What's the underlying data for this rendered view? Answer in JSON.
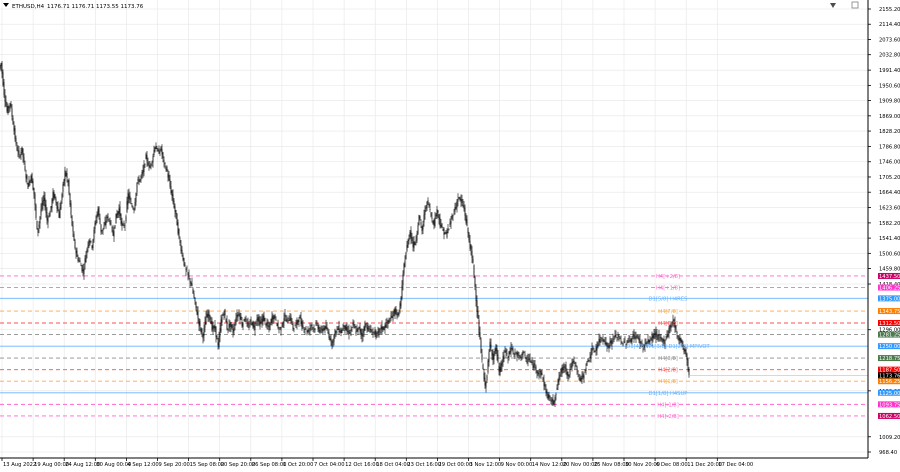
{
  "header": {
    "symbol": "ETHUSD,H4",
    "ohlc": "1176.71 1176.71 1173.55 1173.76"
  },
  "colors": {
    "background": "#ffffff",
    "grid": "#e6e6e6",
    "candle": "#000000",
    "axis_text": "#000000",
    "pink": "#ff66cc",
    "blue": "#66b3ff",
    "orange": "#ffa640",
    "red": "#ff4d4d",
    "gray": "#8c8c8c"
  },
  "chart_data": {
    "type": "candlestick",
    "title": "ETHUSD,H4",
    "y_ticks": [
      "2155.20",
      "2114.40",
      "2073.60",
      "2032.80",
      "1991.40",
      "1950.60",
      "1909.80",
      "1869.00",
      "1828.20",
      "1786.80",
      "1746.00",
      "1705.20",
      "1664.40",
      "1623.60",
      "1582.20",
      "1541.40",
      "1500.60",
      "1459.80",
      "1418.40",
      "1296.00",
      "1132.20",
      "1009.20",
      "968.40"
    ],
    "y_range": [
      955,
      2175
    ],
    "x_ticks": [
      "13 Aug 2022",
      "19 Aug 00:00",
      "24 Aug 12:00",
      "30 Aug 00:00",
      "4 Sep 12:00",
      "9 Sep 20:00",
      "15 Sep 08:00",
      "20 Sep 20:00",
      "26 Sep 08:00",
      "1 Oct 20:00",
      "7 Oct 04:00",
      "12 Oct 16:00",
      "18 Oct 04:00",
      "23 Oct 16:00",
      "29 Oct 00:00",
      "3 Nov 12:00",
      "9 Nov 00:00",
      "14 Nov 12:00",
      "20 Nov 00:00",
      "25 Nov 08:00",
      "30 Nov 20:00",
      "6 Dec 08:00",
      "11 Dec 20:00",
      "17 Dec 04:00"
    ],
    "close_path": [
      [
        0,
        1996
      ],
      [
        2,
        2010
      ],
      [
        5,
        1930
      ],
      [
        8,
        1880
      ],
      [
        11,
        1905
      ],
      [
        14,
        1850
      ],
      [
        17,
        1790
      ],
      [
        20,
        1760
      ],
      [
        23,
        1780
      ],
      [
        26,
        1720
      ],
      [
        29,
        1680
      ],
      [
        32,
        1710
      ],
      [
        35,
        1660
      ],
      [
        38,
        1560
      ],
      [
        40,
        1580
      ],
      [
        42,
        1620
      ],
      [
        45,
        1650
      ],
      [
        48,
        1590
      ],
      [
        51,
        1610
      ],
      [
        54,
        1660
      ],
      [
        57,
        1640
      ],
      [
        60,
        1600
      ],
      [
        63,
        1660
      ],
      [
        66,
        1720
      ],
      [
        69,
        1690
      ],
      [
        72,
        1600
      ],
      [
        75,
        1530
      ],
      [
        78,
        1490
      ],
      [
        81,
        1475
      ],
      [
        84,
        1450
      ],
      [
        87,
        1500
      ],
      [
        90,
        1540
      ],
      [
        93,
        1520
      ],
      [
        96,
        1580
      ],
      [
        99,
        1620
      ],
      [
        102,
        1560
      ],
      [
        105,
        1570
      ],
      [
        108,
        1600
      ],
      [
        111,
        1585
      ],
      [
        114,
        1550
      ],
      [
        117,
        1600
      ],
      [
        120,
        1620
      ],
      [
        123,
        1570
      ],
      [
        126,
        1580
      ],
      [
        129,
        1660
      ],
      [
        132,
        1630
      ],
      [
        135,
        1620
      ],
      [
        138,
        1690
      ],
      [
        141,
        1700
      ],
      [
        144,
        1720
      ],
      [
        147,
        1760
      ],
      [
        150,
        1730
      ],
      [
        153,
        1750
      ],
      [
        156,
        1790
      ],
      [
        159,
        1770
      ],
      [
        162,
        1780
      ],
      [
        165,
        1740
      ],
      [
        168,
        1720
      ],
      [
        171,
        1680
      ],
      [
        174,
        1640
      ],
      [
        177,
        1600
      ],
      [
        180,
        1540
      ],
      [
        183,
        1500
      ],
      [
        186,
        1460
      ],
      [
        189,
        1440
      ],
      [
        192,
        1420
      ],
      [
        195,
        1380
      ],
      [
        198,
        1340
      ],
      [
        201,
        1300
      ],
      [
        204,
        1280
      ],
      [
        207,
        1330
      ],
      [
        210,
        1340
      ],
      [
        213,
        1300
      ],
      [
        216,
        1300
      ],
      [
        219,
        1250
      ],
      [
        222,
        1320
      ],
      [
        225,
        1345
      ],
      [
        228,
        1300
      ],
      [
        231,
        1310
      ],
      [
        234,
        1290
      ],
      [
        237,
        1330
      ],
      [
        240,
        1340
      ],
      [
        243,
        1310
      ],
      [
        246,
        1330
      ],
      [
        249,
        1300
      ],
      [
        252,
        1320
      ],
      [
        255,
        1300
      ],
      [
        258,
        1330
      ],
      [
        261,
        1310
      ],
      [
        264,
        1330
      ],
      [
        267,
        1310
      ],
      [
        270,
        1300
      ],
      [
        273,
        1330
      ],
      [
        276,
        1330
      ],
      [
        279,
        1300
      ],
      [
        282,
        1300
      ],
      [
        285,
        1330
      ],
      [
        288,
        1320
      ],
      [
        291,
        1330
      ],
      [
        294,
        1300
      ],
      [
        297,
        1310
      ],
      [
        300,
        1330
      ],
      [
        303,
        1305
      ],
      [
        306,
        1300
      ],
      [
        309,
        1290
      ],
      [
        312,
        1310
      ],
      [
        315,
        1300
      ],
      [
        318,
        1310
      ],
      [
        321,
        1290
      ],
      [
        324,
        1300
      ],
      [
        327,
        1300
      ],
      [
        330,
        1280
      ],
      [
        333,
        1260
      ],
      [
        336,
        1290
      ],
      [
        339,
        1300
      ],
      [
        342,
        1290
      ],
      [
        345,
        1310
      ],
      [
        348,
        1290
      ],
      [
        351,
        1290
      ],
      [
        354,
        1310
      ],
      [
        357,
        1290
      ],
      [
        360,
        1300
      ],
      [
        363,
        1280
      ],
      [
        366,
        1310
      ],
      [
        369,
        1300
      ],
      [
        372,
        1290
      ],
      [
        375,
        1290
      ],
      [
        378,
        1280
      ],
      [
        381,
        1300
      ],
      [
        384,
        1300
      ],
      [
        387,
        1310
      ],
      [
        390,
        1320
      ],
      [
        393,
        1330
      ],
      [
        396,
        1350
      ],
      [
        399,
        1330
      ],
      [
        402,
        1380
      ],
      [
        405,
        1470
      ],
      [
        408,
        1520
      ],
      [
        411,
        1560
      ],
      [
        414,
        1520
      ],
      [
        417,
        1540
      ],
      [
        420,
        1600
      ],
      [
        423,
        1560
      ],
      [
        426,
        1620
      ],
      [
        429,
        1640
      ],
      [
        432,
        1600
      ],
      [
        435,
        1580
      ],
      [
        438,
        1620
      ],
      [
        441,
        1580
      ],
      [
        444,
        1560
      ],
      [
        447,
        1550
      ],
      [
        450,
        1570
      ],
      [
        453,
        1600
      ],
      [
        456,
        1620
      ],
      [
        459,
        1650
      ],
      [
        462,
        1640
      ],
      [
        465,
        1620
      ],
      [
        468,
        1570
      ],
      [
        471,
        1520
      ],
      [
        474,
        1470
      ],
      [
        477,
        1380
      ],
      [
        480,
        1290
      ],
      [
        483,
        1210
      ],
      [
        486,
        1140
      ],
      [
        488,
        1180
      ],
      [
        491,
        1260
      ],
      [
        494,
        1220
      ],
      [
        497,
        1250
      ],
      [
        500,
        1180
      ],
      [
        503,
        1210
      ],
      [
        506,
        1240
      ],
      [
        509,
        1220
      ],
      [
        512,
        1250
      ],
      [
        515,
        1230
      ],
      [
        518,
        1230
      ],
      [
        521,
        1220
      ],
      [
        524,
        1240
      ],
      [
        527,
        1210
      ],
      [
        530,
        1220
      ],
      [
        533,
        1200
      ],
      [
        536,
        1200
      ],
      [
        539,
        1180
      ],
      [
        542,
        1180
      ],
      [
        545,
        1150
      ],
      [
        548,
        1120
      ],
      [
        551,
        1110
      ],
      [
        554,
        1100
      ],
      [
        557,
        1130
      ],
      [
        560,
        1170
      ],
      [
        563,
        1190
      ],
      [
        566,
        1200
      ],
      [
        569,
        1170
      ],
      [
        572,
        1200
      ],
      [
        575,
        1210
      ],
      [
        578,
        1190
      ],
      [
        581,
        1160
      ],
      [
        584,
        1170
      ],
      [
        587,
        1200
      ],
      [
        590,
        1220
      ],
      [
        593,
        1240
      ],
      [
        596,
        1240
      ],
      [
        599,
        1260
      ],
      [
        602,
        1275
      ],
      [
        605,
        1270
      ],
      [
        608,
        1250
      ],
      [
        611,
        1260
      ],
      [
        614,
        1270
      ],
      [
        617,
        1280
      ],
      [
        620,
        1275
      ],
      [
        623,
        1260
      ],
      [
        626,
        1260
      ],
      [
        629,
        1265
      ],
      [
        632,
        1270
      ],
      [
        635,
        1280
      ],
      [
        638,
        1275
      ],
      [
        641,
        1265
      ],
      [
        644,
        1250
      ],
      [
        647,
        1260
      ],
      [
        650,
        1265
      ],
      [
        653,
        1275
      ],
      [
        656,
        1285
      ],
      [
        659,
        1275
      ],
      [
        662,
        1270
      ],
      [
        665,
        1265
      ],
      [
        668,
        1280
      ],
      [
        671,
        1305
      ],
      [
        674,
        1320
      ],
      [
        676,
        1305
      ],
      [
        678,
        1280
      ],
      [
        681,
        1270
      ],
      [
        684,
        1250
      ],
      [
        687,
        1230
      ],
      [
        690,
        1173
      ]
    ],
    "levels": [
      {
        "value": 1440.0,
        "label": "H4[+2/8]",
        "tag": "1437.50",
        "color": "#ff66cc",
        "dash": true,
        "tag_fill": "#cc0066"
      },
      {
        "value": 1409.0,
        "label": "H4[+1/8]",
        "tag": "1406.25",
        "color": "#ff66cc",
        "dash": true,
        "tag_fill": "#ff33cc"
      },
      {
        "value": 1380.0,
        "label": "D1[5/8] H4RES",
        "tag": "1375.00",
        "color": "#66b3ff",
        "dash": false,
        "tag_fill": "#3399ff"
      },
      {
        "value": 1346.0,
        "label": "H4[7/8]",
        "tag": "1343.75",
        "color": "#ffa640",
        "dash": true,
        "tag_fill": "#ff8000"
      },
      {
        "value": 1314.0,
        "label": "H4[6/8]",
        "tag": "1312.50",
        "color": "#ff4d4d",
        "dash": true,
        "tag_fill": "#ff0000"
      },
      {
        "value": 1283.0,
        "label": "",
        "tag": "1281.25",
        "color": "#8c8c8c",
        "dash": true,
        "tag_fill": "#4d7a4d"
      },
      {
        "value": 1252.0,
        "label": "D1[4/8]W1[3/8] D1[2/8] MPIVOT",
        "tag": "1250.00",
        "color": "#66b3ff",
        "dash": false,
        "tag_fill": "#3399ff"
      },
      {
        "value": 1220.0,
        "label": "H4[3/8]",
        "tag": "1218.75",
        "color": "#8c8c8c",
        "dash": true,
        "tag_fill": "#4d7a4d"
      },
      {
        "value": 1189.0,
        "label": "H4[2/8]",
        "tag": "1187.50",
        "color": "#ff4d4d",
        "dash": true,
        "tag_fill": "#ff0000"
      },
      {
        "value": 1158.0,
        "label": "H4[1/8]",
        "tag": "1156.25",
        "color": "#ffa640",
        "dash": true,
        "tag_fill": "#ff8000"
      },
      {
        "value": 1127.0,
        "label": "D1[1/8] H4SUP",
        "tag": "1125.00",
        "color": "#66b3ff",
        "dash": false,
        "tag_fill": "#3399ff"
      },
      {
        "value": 1096.0,
        "label": "H4[-1/8]",
        "tag": "1093.75",
        "color": "#ff66cc",
        "dash": true,
        "tag_fill": "#ff33cc"
      },
      {
        "value": 1065.0,
        "label": "H4[-2/8]",
        "tag": "1062.50",
        "color": "#ff66cc",
        "dash": true,
        "tag_fill": "#cc0066"
      }
    ],
    "current_price": {
      "value": 1173.76,
      "tag": "1173.76",
      "tag_fill": "#000000"
    },
    "grid": true
  }
}
